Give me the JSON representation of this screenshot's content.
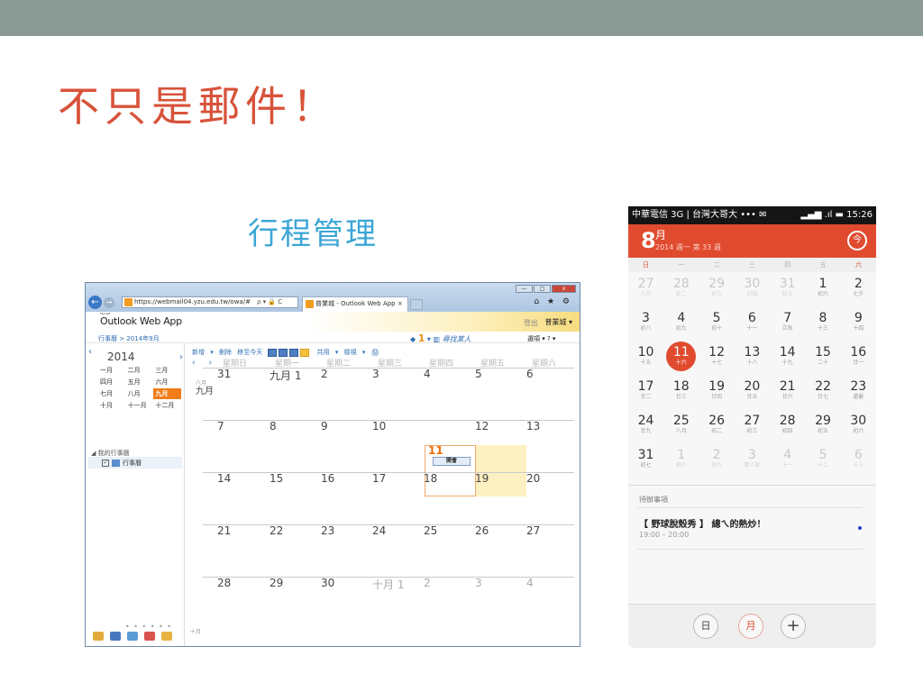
{
  "slide": {
    "title": "不只是郵件！",
    "subtitle": "行程管理",
    "topbar_color": "#8b9a94",
    "title_color": "#d8523a",
    "subtitle_color": "#3ca6d6"
  },
  "outlook": {
    "window_buttons": [
      "—",
      "□",
      "x"
    ],
    "url": "https://webmail04.yzu.edu.tw/owa/#",
    "url_tools": "ρ ▾ 🔒 C",
    "tab_title": "普業城 - Outlook Web App",
    "tab_close": "×",
    "right_tools": "⌂ ★ ⚙",
    "logo_small": "Microsoft",
    "logo": "Outlook Web App",
    "sign_out": "登出",
    "user": "普業城 ▾",
    "breadcrumb": "行事曆 > 2014年9月",
    "people_count": "1",
    "people_search": "尋找某人",
    "options": "選項 ▾  ? ▾",
    "year": "2014",
    "year_prev": "‹",
    "year_next": "›",
    "months": [
      "一月",
      "二月",
      "三月",
      "四月",
      "五月",
      "六月",
      "七月",
      "八月",
      "九月",
      "十月",
      "十一月",
      "十二月"
    ],
    "selected_month": "九月",
    "my_calendars": "◢ 我的行事曆",
    "calendar_name": "行事曆",
    "checkbox_mark": "✓",
    "sidebar_dots": "• • • • • •",
    "toolbar": "新增 ▾  刪除   移至今天",
    "toolbar_share": "共用 ▾  檢視 ▾  🖨",
    "nav_arrows": "‹ ›",
    "weekdays": [
      "星期日",
      "星期一",
      "星期二",
      "星期三",
      "星期四",
      "星期五",
      "星期六"
    ],
    "month_label_small": "八月",
    "month_label": "九月",
    "weeks": [
      [
        "31",
        "九月 1",
        "2",
        "3",
        "4",
        "5",
        "6"
      ],
      [
        "7",
        "8",
        "9",
        "10",
        "11",
        "12",
        "13"
      ],
      [
        "14",
        "15",
        "16",
        "17",
        "18",
        "19",
        "20"
      ],
      [
        "21",
        "22",
        "23",
        "24",
        "25",
        "26",
        "27"
      ],
      [
        "28",
        "29",
        "30",
        "十月 1",
        "2",
        "3",
        "4"
      ]
    ],
    "today": "11",
    "meeting": "開會",
    "footer_month": "十月"
  },
  "phone": {
    "status_left": "中華電信 3G | 台灣大哥大 ••• ✉",
    "status_right": "▂▄▆ .ıl ▬ 15:26",
    "month_num": "8",
    "month_char": "月",
    "year_week": "2014  週一 第 33 週",
    "today_button": "今",
    "header_color": "#e04b30",
    "weekdays": [
      "日",
      "一",
      "二",
      "三",
      "四",
      "五",
      "六"
    ],
    "weeks": [
      [
        {
          "n": "27",
          "l": "七月",
          "o": true
        },
        {
          "n": "28",
          "l": "初二",
          "o": true
        },
        {
          "n": "29",
          "l": "初三",
          "o": true
        },
        {
          "n": "30",
          "l": "初四",
          "o": true
        },
        {
          "n": "31",
          "l": "初五",
          "o": true
        },
        {
          "n": "1",
          "l": "初六"
        },
        {
          "n": "2",
          "l": "七夕"
        }
      ],
      [
        {
          "n": "3",
          "l": "初八"
        },
        {
          "n": "4",
          "l": "初九"
        },
        {
          "n": "5",
          "l": "初十"
        },
        {
          "n": "6",
          "l": "十一"
        },
        {
          "n": "7",
          "l": "立秋"
        },
        {
          "n": "8",
          "l": "十三"
        },
        {
          "n": "9",
          "l": "十四"
        }
      ],
      [
        {
          "n": "10",
          "l": "十五"
        },
        {
          "n": "11",
          "l": "十六",
          "sel": true
        },
        {
          "n": "12",
          "l": "十七"
        },
        {
          "n": "13",
          "l": "十八"
        },
        {
          "n": "14",
          "l": "十九"
        },
        {
          "n": "15",
          "l": "二十"
        },
        {
          "n": "16",
          "l": "廿一"
        }
      ],
      [
        {
          "n": "17",
          "l": "廿二"
        },
        {
          "n": "18",
          "l": "廿三"
        },
        {
          "n": "19",
          "l": "廿四"
        },
        {
          "n": "20",
          "l": "廿五"
        },
        {
          "n": "21",
          "l": "廿六"
        },
        {
          "n": "22",
          "l": "廿七"
        },
        {
          "n": "23",
          "l": "處暑"
        }
      ],
      [
        {
          "n": "24",
          "l": "廿九"
        },
        {
          "n": "25",
          "l": "八月"
        },
        {
          "n": "26",
          "l": "初二"
        },
        {
          "n": "27",
          "l": "初三"
        },
        {
          "n": "28",
          "l": "初四"
        },
        {
          "n": "29",
          "l": "初五"
        },
        {
          "n": "30",
          "l": "初六"
        }
      ],
      [
        {
          "n": "31",
          "l": "初七"
        },
        {
          "n": "1",
          "l": "初八",
          "o": true
        },
        {
          "n": "2",
          "l": "初九",
          "o": true
        },
        {
          "n": "3",
          "l": "軍人節",
          "o": true
        },
        {
          "n": "4",
          "l": "十一",
          "o": true
        },
        {
          "n": "5",
          "l": "十二",
          "o": true
        },
        {
          "n": "6",
          "l": "十三",
          "o": true
        }
      ]
    ],
    "todo_header": "待辦事項",
    "event_title": "【 野球脫殼秀 】 總ㄟ的熱炒！",
    "event_time": "19:00 – 20:00",
    "btn_day": "日",
    "btn_month": "月",
    "btn_add": "+"
  }
}
